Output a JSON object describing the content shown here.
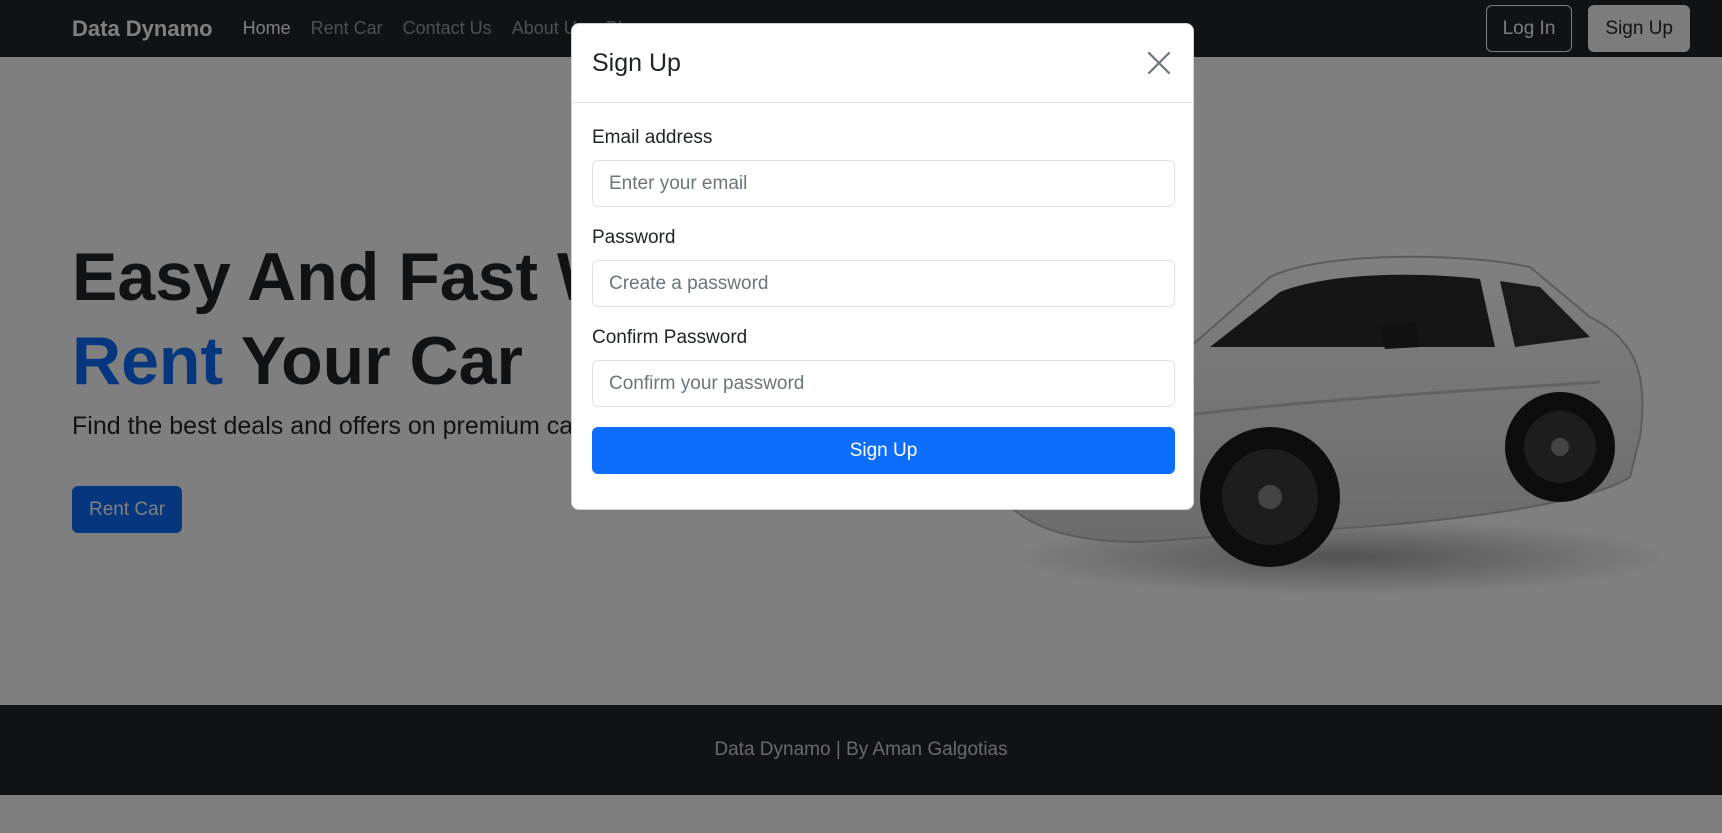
{
  "navbar": {
    "brand": "Data Dynamo",
    "links": [
      {
        "label": "Home",
        "active": true
      },
      {
        "label": "Rent Car",
        "active": false
      },
      {
        "label": "Contact Us",
        "active": false
      },
      {
        "label": "About Us",
        "active": false
      },
      {
        "label": "Blog",
        "active": false
      }
    ],
    "login_label": "Log In",
    "signup_label": "Sign Up"
  },
  "hero": {
    "title_line1": "Easy And Fast Way To",
    "title_accent": "Rent",
    "title_line2_rest": " Your Car",
    "subtitle": "Find the best deals and offers on premium cars.",
    "cta_label": "Rent Car"
  },
  "footer": {
    "text": "Data Dynamo | By Aman Galgotias"
  },
  "modal": {
    "title": "Sign Up",
    "close_icon": "close-icon",
    "fields": [
      {
        "label": "Email address",
        "placeholder": "Enter your email",
        "value": ""
      },
      {
        "label": "Password",
        "placeholder": "Create a password",
        "value": ""
      },
      {
        "label": "Confirm Password",
        "placeholder": "Confirm your password",
        "value": ""
      }
    ],
    "submit_label": "Sign Up"
  },
  "colors": {
    "primary": "#0d6efd",
    "dark": "#212529",
    "backdrop": "rgba(0,0,0,0.5)"
  }
}
